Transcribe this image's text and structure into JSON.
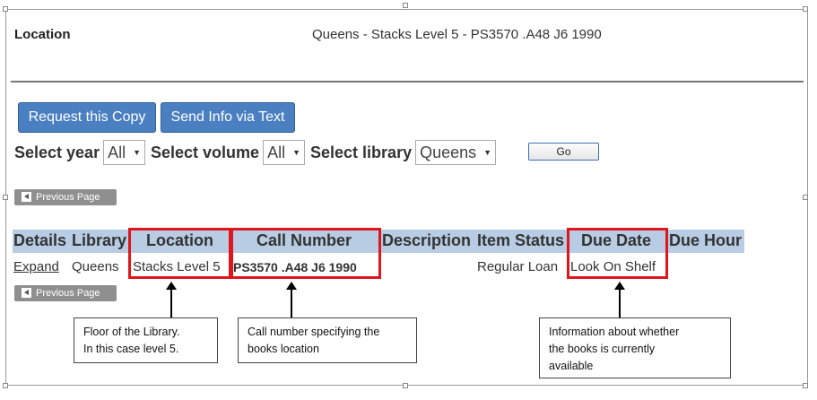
{
  "location": {
    "label": "Location",
    "value": "Queens - Stacks Level 5 - PS3570 .A48 J6 1990"
  },
  "buttons": {
    "request": "Request this Copy",
    "send_text": "Send Info via Text",
    "go": "Go"
  },
  "filters": {
    "year_label": "Select year",
    "year_value": "All",
    "volume_label": "Select volume",
    "volume_value": "All",
    "library_label": "Select library",
    "library_value": "Queens"
  },
  "pager": {
    "previous": "Previous Page"
  },
  "table": {
    "headers": [
      "Details",
      "Library",
      "Location",
      "Call Number",
      "Description",
      "Item Status",
      "Due Date",
      "Due Hour"
    ],
    "row": {
      "details": "Expand",
      "library": "Queens",
      "location": "Stacks Level 5",
      "call_number": "PS3570 .A48 J6 1990",
      "description": "",
      "item_status": "Regular Loan",
      "due_date": "Look On Shelf",
      "due_hour": ""
    }
  },
  "annotations": {
    "floor_line1": "Floor of the Library.",
    "floor_line2": "In this case level 5.",
    "callnum_line1": "Call number specifying the",
    "callnum_line2": "books location",
    "status_line1": "Information about whether",
    "status_line2": "the books is currently",
    "status_line3": "available"
  },
  "colors": {
    "button_blue": "#4a7fc1",
    "header_band": "#b8cce4",
    "highlight_red": "#e0161d"
  }
}
